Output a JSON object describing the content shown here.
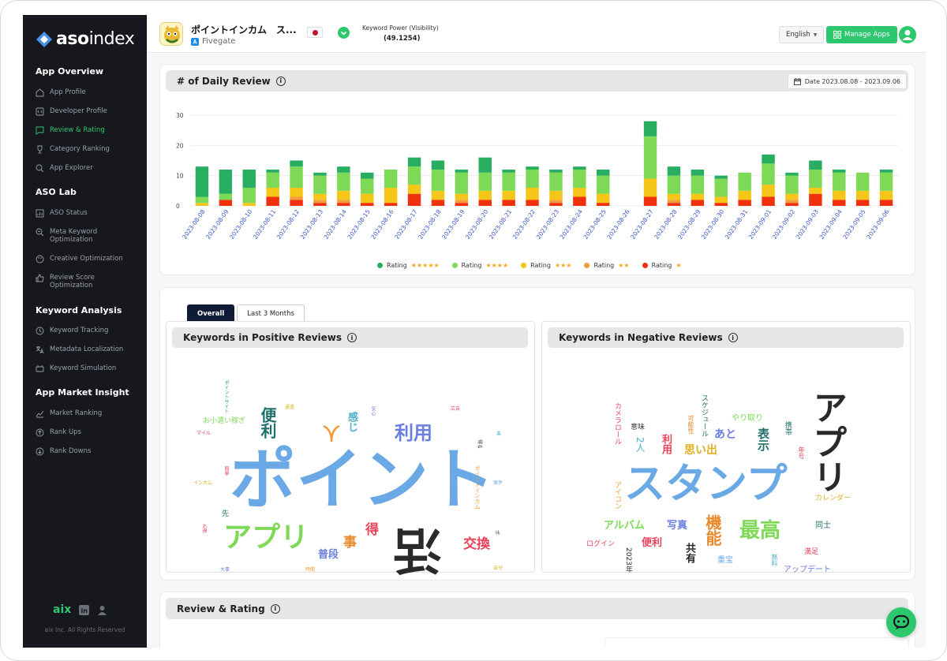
{
  "sidebar": {
    "logo": {
      "text_bold": "aso",
      "text_thin": "index"
    },
    "sections": [
      {
        "title": "App Overview",
        "items": [
          {
            "label": "App Profile",
            "icon": "home-icon",
            "active": false
          },
          {
            "label": "Developer Profile",
            "icon": "code-icon",
            "active": false
          },
          {
            "label": "Review & Rating",
            "icon": "chat-icon",
            "active": true
          },
          {
            "label": "Category Ranking",
            "icon": "trophy-icon",
            "active": false
          },
          {
            "label": "App Explorer",
            "icon": "search-icon",
            "active": false
          }
        ]
      },
      {
        "title": "ASO Lab",
        "items": [
          {
            "label": "ASO Status",
            "icon": "status-icon",
            "active": false
          },
          {
            "label": "Meta Keyword\nOptimization",
            "icon": "magnify-icon",
            "active": false
          },
          {
            "label": "Creative Optimization",
            "icon": "palette-icon",
            "active": false
          },
          {
            "label": "Review Score\nOptimization",
            "icon": "thumb-icon",
            "active": false
          }
        ]
      },
      {
        "title": "Keyword Analysis",
        "items": [
          {
            "label": "Keyword Tracking",
            "icon": "tracking-icon",
            "active": false
          },
          {
            "label": "Metadata Localization",
            "icon": "localization-icon",
            "active": false
          },
          {
            "label": "Keyword Simulation",
            "icon": "simulation-icon",
            "active": false
          }
        ]
      },
      {
        "title": "App Market Insight",
        "items": [
          {
            "label": "Market Ranking",
            "icon": "trend-icon",
            "active": false
          },
          {
            "label": "Rank Ups",
            "icon": "arrow-up-icon",
            "active": false
          },
          {
            "label": "Rank Downs",
            "icon": "arrow-down-icon",
            "active": false
          }
        ]
      }
    ],
    "footer": {
      "brand": "aix",
      "copyright": "aix Inc. All Rights Reserved"
    }
  },
  "topbar": {
    "app_title": "ポイントインカム　ス...",
    "developer": "Fivegate",
    "keyword_power_label": "Keyword Power (Visibility)",
    "keyword_power_value": "(49.1254)",
    "language": "English",
    "manage_apps": "Manage Apps"
  },
  "daily_review": {
    "title": "# of Daily Review",
    "date_range": "Date 2023.08.08 - 2023.09.06",
    "legend": [
      {
        "label": "Rating",
        "stars": "★★★★★",
        "color": "#27ae60"
      },
      {
        "label": "Rating",
        "stars": "★★★★",
        "color": "#7ed957"
      },
      {
        "label": "Rating",
        "stars": "★★★",
        "color": "#f5c518"
      },
      {
        "label": "Rating",
        "stars": "★★",
        "color": "#f39c3c"
      },
      {
        "label": "Rating",
        "stars": "★",
        "color": "#f1300e"
      }
    ]
  },
  "chart_data": {
    "type": "bar",
    "stacked": true,
    "categories": [
      "2023-08-08",
      "2023-08-09",
      "2023-08-10",
      "2023-08-11",
      "2023-08-12",
      "2023-08-13",
      "2023-08-14",
      "2023-08-15",
      "2023-08-16",
      "2023-08-17",
      "2023-08-18",
      "2023-08-19",
      "2023-08-20",
      "2023-08-21",
      "2023-08-22",
      "2023-08-23",
      "2023-08-24",
      "2023-08-25",
      "2023-08-26",
      "2023-08-27",
      "2023-08-28",
      "2023-08-29",
      "2023-08-30",
      "2023-08-31",
      "2023-09-01",
      "2023-09-02",
      "2023-09-03",
      "2023-09-04",
      "2023-09-05",
      "2023-09-06"
    ],
    "series": [
      {
        "name": "Rating ★",
        "color": "#f1300e",
        "values": [
          0,
          2,
          0,
          3,
          2,
          1,
          1,
          1,
          1,
          4,
          2,
          1,
          2,
          2,
          2,
          1,
          3,
          1,
          0,
          3,
          1,
          2,
          1,
          2,
          3,
          1,
          4,
          2,
          2,
          2
        ]
      },
      {
        "name": "Rating ★★",
        "color": "#f39c3c",
        "values": [
          0,
          0,
          0,
          0,
          1,
          1,
          1,
          0,
          0,
          0,
          0,
          1,
          0,
          0,
          0,
          1,
          0,
          0,
          0,
          0,
          1,
          0,
          0,
          0,
          0,
          1,
          0,
          0,
          0,
          0
        ]
      },
      {
        "name": "Rating ★★★",
        "color": "#f5c518",
        "values": [
          1,
          0,
          1,
          3,
          3,
          2,
          3,
          3,
          5,
          3,
          3,
          2,
          3,
          3,
          4,
          3,
          3,
          3,
          0,
          6,
          2,
          2,
          2,
          3,
          4,
          2,
          2,
          3,
          3,
          3
        ]
      },
      {
        "name": "Rating ★★★★",
        "color": "#7ed957",
        "values": [
          2,
          2,
          5,
          5,
          7,
          6,
          6,
          5,
          6,
          6,
          7,
          7,
          6,
          6,
          6,
          6,
          6,
          6,
          0,
          14,
          6,
          6,
          6,
          6,
          7,
          6,
          6,
          6,
          6,
          6
        ]
      },
      {
        "name": "Rating ★★★★★",
        "color": "#27ae60",
        "values": [
          10,
          8,
          6,
          1,
          2,
          1,
          2,
          2,
          0,
          3,
          3,
          1,
          5,
          1,
          1,
          1,
          1,
          2,
          0,
          5,
          3,
          2,
          1,
          0,
          3,
          1,
          3,
          1,
          0,
          1
        ]
      }
    ],
    "yticks": [
      0,
      10,
      20,
      30
    ],
    "ylim": [
      0,
      30
    ],
    "grid": true,
    "legend_position": "bottom"
  },
  "tabs": [
    {
      "label": "Overall",
      "active": true
    },
    {
      "label": "Last 3 Months",
      "active": false
    }
  ],
  "positive": {
    "title": "Keywords in Positive Reviews",
    "words": [
      {
        "t": "ポイント",
        "c": "#6aa8e6",
        "s": 84,
        "x": 80,
        "y": 124
      },
      {
        "t": "アプリ",
        "c": "#7ed957",
        "s": 36,
        "x": 72,
        "y": 222
      },
      {
        "t": "活",
        "c": "#2a2a2a",
        "s": 62,
        "x": 287,
        "y": 224,
        "r": 180
      },
      {
        "t": "利用",
        "c": "#6a7fe0",
        "s": 24,
        "x": 289,
        "y": 95
      },
      {
        "t": "便利",
        "c": "#1f6f6a",
        "s": 20,
        "x": 118,
        "y": 74,
        "v": true
      },
      {
        "t": "人",
        "c": "#f39c3c",
        "s": 22,
        "x": 198,
        "y": 94,
        "r": 180
      },
      {
        "t": "感じ",
        "c": "#4fb3c7",
        "s": 13,
        "x": 228,
        "y": 80,
        "v": true
      },
      {
        "t": "交換",
        "c": "#e8455a",
        "s": 17,
        "x": 376,
        "y": 240
      },
      {
        "t": "得",
        "c": "#e8455a",
        "s": 17,
        "x": 252,
        "y": 222
      },
      {
        "t": "事",
        "c": "#e88a2d",
        "s": 17,
        "x": 224,
        "y": 238
      },
      {
        "t": "普段",
        "c": "#6a7fe0",
        "s": 13,
        "x": 192,
        "y": 255
      },
      {
        "t": "お小遣い稼ぎ",
        "c": "#7ed957",
        "s": 9,
        "x": 46,
        "y": 88
      },
      {
        "t": "ポイントサイト",
        "c": "#27ae60",
        "s": 6,
        "x": 72,
        "y": 40,
        "v": true
      },
      {
        "t": "ポイントインカム",
        "c": "#f39c3c",
        "s": 7,
        "x": 390,
        "y": 148,
        "v": true
      },
      {
        "t": "広告",
        "c": "#e8455a",
        "s": 6,
        "x": 360,
        "y": 74
      },
      {
        "t": "マイル",
        "c": "#e8455a",
        "s": 6,
        "x": 38,
        "y": 105
      },
      {
        "t": "インカム",
        "c": "#e0b020",
        "s": 6,
        "x": 34,
        "y": 168
      },
      {
        "t": "案件",
        "c": "#6aa8e6",
        "s": 6,
        "x": 414,
        "y": 168
      },
      {
        "t": "先",
        "c": "#1f6f6a",
        "s": 9,
        "x": 70,
        "y": 206
      },
      {
        "t": "簡単",
        "c": "#e8455a",
        "s": 6,
        "x": 72,
        "y": 149,
        "v": true
      },
      {
        "t": "安心",
        "c": "#6a7fe0",
        "s": 6,
        "x": 258,
        "y": 73,
        "v": true
      },
      {
        "t": "通過",
        "c": "#e0b020",
        "s": 6,
        "x": 150,
        "y": 72
      },
      {
        "t": "得る",
        "c": "#333333",
        "s": 6,
        "x": 390,
        "y": 118,
        "r": 90
      },
      {
        "t": "楽",
        "c": "#4fb3c7",
        "s": 6,
        "x": 418,
        "y": 106
      },
      {
        "t": "お得",
        "c": "#e8455a",
        "s": 6,
        "x": 44,
        "y": 222,
        "v": true
      },
      {
        "t": "大事",
        "c": "#6a7fe0",
        "s": 6,
        "x": 68,
        "y": 278
      },
      {
        "t": "時間",
        "c": "#f39c3c",
        "s": 6,
        "x": 176,
        "y": 278
      },
      {
        "t": "自分",
        "c": "#e0b020",
        "s": 6,
        "x": 414,
        "y": 276
      },
      {
        "t": "ポ",
        "c": "#333333",
        "s": 6,
        "x": 415,
        "y": 230,
        "r": 90
      }
    ]
  },
  "negative": {
    "title": "Keywords in Negative Reviews",
    "words": [
      {
        "t": "スタンプ",
        "c": "#6aa8e6",
        "s": 52,
        "x": 104,
        "y": 146
      },
      {
        "t": "アプリ",
        "c": "#2a2a2a",
        "s": 44,
        "x": 338,
        "y": 52,
        "v": true
      },
      {
        "t": "最高",
        "c": "#7ed957",
        "s": 26,
        "x": 250,
        "y": 218
      },
      {
        "t": "機能",
        "c": "#e88a2d",
        "s": 20,
        "x": 206,
        "y": 210,
        "v": true
      },
      {
        "t": "表示",
        "c": "#1f6f6a",
        "s": 15,
        "x": 272,
        "y": 100,
        "v": true
      },
      {
        "t": "思い出",
        "c": "#e0b020",
        "s": 14,
        "x": 180,
        "y": 122
      },
      {
        "t": "あと",
        "c": "#6a7fe0",
        "s": 14,
        "x": 218,
        "y": 102
      },
      {
        "t": "利用",
        "c": "#e8455a",
        "s": 13,
        "x": 150,
        "y": 108,
        "v": true
      },
      {
        "t": "2人",
        "c": "#4fb3c7",
        "s": 12,
        "x": 118,
        "y": 112,
        "v": true
      },
      {
        "t": "アルバム",
        "c": "#7ed957",
        "s": 13,
        "x": 78,
        "y": 218
      },
      {
        "t": "写真",
        "c": "#6a7fe0",
        "s": 13,
        "x": 158,
        "y": 218
      },
      {
        "t": "便利",
        "c": "#e8455a",
        "s": 13,
        "x": 126,
        "y": 240
      },
      {
        "t": "共有",
        "c": "#2a2a2a",
        "s": 13,
        "x": 180,
        "y": 246,
        "v": true
      },
      {
        "t": "重宝",
        "c": "#6aa8e6",
        "s": 10,
        "x": 222,
        "y": 264
      },
      {
        "t": "同士",
        "c": "#1f6f6a",
        "s": 10,
        "x": 346,
        "y": 220
      },
      {
        "t": "満足",
        "c": "#e8455a",
        "s": 9,
        "x": 332,
        "y": 254
      },
      {
        "t": "アップデート",
        "c": "#6a7fe0",
        "s": 10,
        "x": 306,
        "y": 276
      },
      {
        "t": "カメラロール",
        "c": "#e8455a",
        "s": 9,
        "x": 90,
        "y": 68,
        "v": true
      },
      {
        "t": "スケジュール",
        "c": "#1f6f6a",
        "s": 9,
        "x": 200,
        "y": 58,
        "v": true
      },
      {
        "t": "可能性",
        "c": "#e88a2d",
        "s": 8,
        "x": 184,
        "y": 84,
        "v": true
      },
      {
        "t": "やり取り",
        "c": "#7ed957",
        "s": 10,
        "x": 240,
        "y": 84
      },
      {
        "t": "携帯",
        "c": "#1f6f6a",
        "s": 9,
        "x": 306,
        "y": 92,
        "v": true
      },
      {
        "t": "年号",
        "c": "#e8455a",
        "s": 8,
        "x": 324,
        "y": 124,
        "v": true
      },
      {
        "t": "意味",
        "c": "#333333",
        "s": 9,
        "x": 112,
        "y": 96
      },
      {
        "t": "アイコン",
        "c": "#f39c3c",
        "s": 9,
        "x": 90,
        "y": 168,
        "v": true
      },
      {
        "t": "カレンダー",
        "c": "#e0b020",
        "s": 9,
        "x": 346,
        "y": 186
      },
      {
        "t": "ログイン",
        "c": "#e8455a",
        "s": 9,
        "x": 56,
        "y": 244
      },
      {
        "t": "2023年",
        "c": "#2a2a2a",
        "s": 9,
        "x": 104,
        "y": 252,
        "v": true
      },
      {
        "t": "無料",
        "c": "#4fb3c7",
        "s": 8,
        "x": 290,
        "y": 260,
        "v": true
      }
    ]
  },
  "review_rating": {
    "title": "Review & Rating"
  },
  "colors": {
    "accent": "#2dc76d",
    "sidebar_bg": "#16181d",
    "tab_active_bg": "#0e1a36"
  }
}
